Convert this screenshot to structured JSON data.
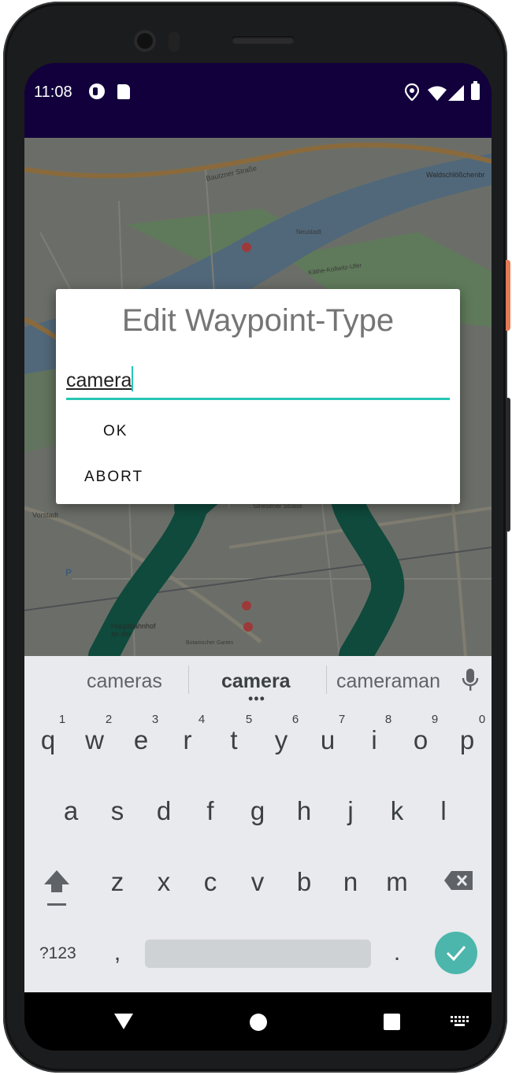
{
  "status_bar": {
    "time": "11:08"
  },
  "dialog": {
    "title": "Edit Waypoint-Type",
    "input_value": "camera",
    "ok_label": "OK",
    "abort_label": "ABORT"
  },
  "map_labels": {
    "street_1": "Bautzner Straße",
    "street_2": "Waldschlößchenbr",
    "street_3": "Käthe-Kollwitz-Ufer",
    "street_4": "Striesener Straße",
    "street_5": "Vorstadt",
    "street_6": "Hauptbahnhof an der",
    "street_7": "Botanischer Garten",
    "street_8": "Neustadt"
  },
  "keyboard": {
    "suggestions": [
      "cameras",
      "camera",
      "cameraman"
    ],
    "row1": [
      "q",
      "w",
      "e",
      "r",
      "t",
      "y",
      "u",
      "i",
      "o",
      "p"
    ],
    "row1_hints": [
      "1",
      "2",
      "3",
      "4",
      "5",
      "6",
      "7",
      "8",
      "9",
      "0"
    ],
    "row2": [
      "a",
      "s",
      "d",
      "f",
      "g",
      "h",
      "j",
      "k",
      "l"
    ],
    "row3": [
      "z",
      "x",
      "c",
      "v",
      "b",
      "n",
      "m"
    ],
    "symbols_label": "?123",
    "comma": ",",
    "period": "."
  },
  "colors": {
    "status_bar": "#12003d",
    "accent": "#26c6b4",
    "route": "#0f4a3c",
    "enter_key": "#4db6ac"
  }
}
